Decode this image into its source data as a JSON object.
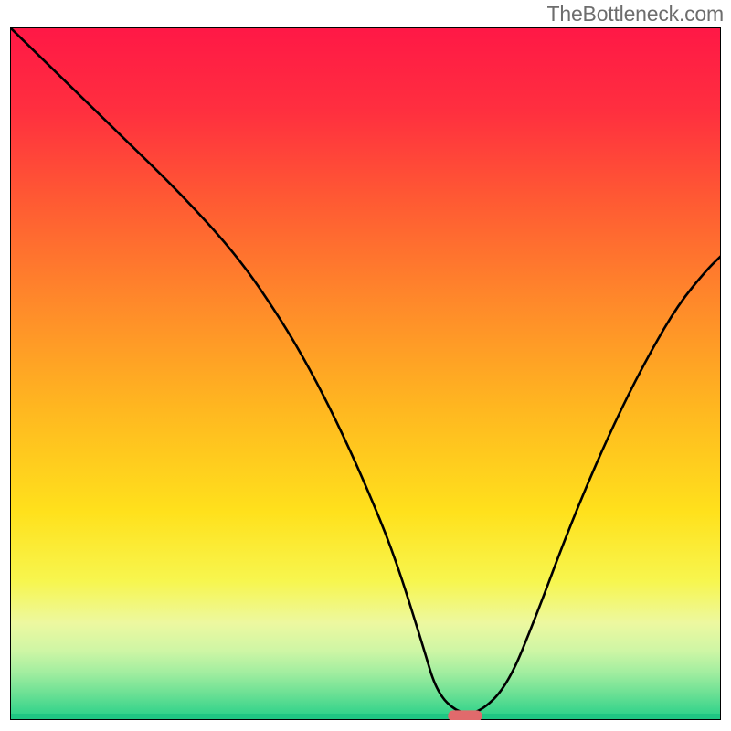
{
  "attribution": "TheBottleneck.com",
  "chart_data": {
    "type": "line",
    "title": "",
    "xlabel": "",
    "ylabel": "",
    "xlim": [
      0,
      100
    ],
    "ylim": [
      0,
      100
    ],
    "grid": false,
    "legend": false,
    "gradient_stops": [
      {
        "pos": 0.0,
        "color": "#ff1846"
      },
      {
        "pos": 0.12,
        "color": "#ff2f3f"
      },
      {
        "pos": 0.25,
        "color": "#ff5a33"
      },
      {
        "pos": 0.4,
        "color": "#ff8a2a"
      },
      {
        "pos": 0.55,
        "color": "#ffb720"
      },
      {
        "pos": 0.7,
        "color": "#ffe11c"
      },
      {
        "pos": 0.8,
        "color": "#f7f64f"
      },
      {
        "pos": 0.86,
        "color": "#edf8a0"
      },
      {
        "pos": 0.9,
        "color": "#cef6a5"
      },
      {
        "pos": 0.93,
        "color": "#a4eea0"
      },
      {
        "pos": 0.96,
        "color": "#6fe195"
      },
      {
        "pos": 0.985,
        "color": "#3fd68d"
      },
      {
        "pos": 1.0,
        "color": "#21cf88"
      }
    ],
    "series": [
      {
        "name": "bottleneck-curve",
        "x": [
          0,
          8,
          16,
          24,
          32,
          38,
          42,
          46,
          50,
          54,
          58,
          60,
          63,
          66,
          70,
          74,
          78,
          82,
          86,
          90,
          94,
          98,
          100
        ],
        "y": [
          100,
          92,
          84,
          76,
          67,
          58,
          51,
          43,
          34,
          24,
          11,
          4,
          1,
          1,
          5,
          15,
          26,
          36,
          45,
          53,
          60,
          65,
          67
        ]
      }
    ],
    "marker": {
      "name": "optimal-point",
      "x": 64,
      "y": 0.6,
      "width": 4.8,
      "height": 1.6,
      "color": "#e16a6c"
    }
  }
}
